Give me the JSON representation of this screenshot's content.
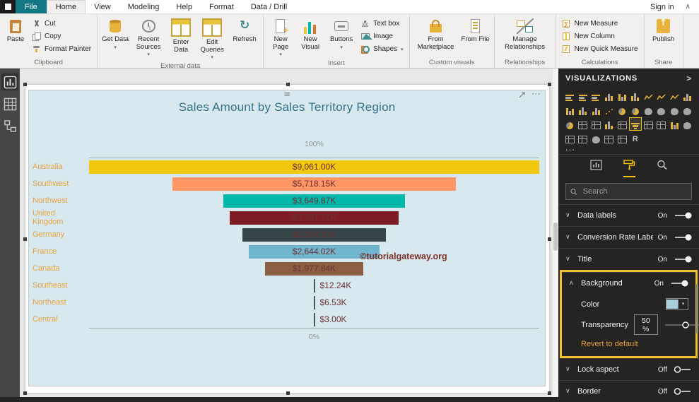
{
  "app": {
    "file_label": "File",
    "tabs": [
      "Home",
      "View",
      "Modeling",
      "Help",
      "Format",
      "Data / Drill"
    ],
    "active_tab": "Home",
    "sign_in_label": "Sign in",
    "collapse_ribbon_icon": "∧"
  },
  "ribbon": {
    "groups": [
      {
        "label": "Clipboard",
        "buttons": [
          {
            "label": "Paste",
            "icon": "paste-icon"
          },
          {
            "label": "Cut",
            "icon": "scissors-icon",
            "size": "small"
          },
          {
            "label": "Copy",
            "icon": "copy-icon",
            "size": "small"
          },
          {
            "label": "Format Painter",
            "icon": "format-painter-icon",
            "size": "small"
          }
        ]
      },
      {
        "label": "External data",
        "buttons": [
          {
            "label": "Get Data",
            "icon": "database-icon",
            "dropdown": true
          },
          {
            "label": "Recent Sources",
            "icon": "recent-sources-icon",
            "dropdown": true
          },
          {
            "label": "Enter Data",
            "icon": "enter-data-icon"
          },
          {
            "label": "Edit Queries",
            "icon": "edit-queries-icon",
            "dropdown": true
          },
          {
            "label": "Refresh",
            "icon": "refresh-icon"
          }
        ]
      },
      {
        "label": "Insert",
        "buttons": [
          {
            "label": "New Page",
            "icon": "new-page-icon",
            "dropdown": true
          },
          {
            "label": "New Visual",
            "icon": "new-visual-icon"
          },
          {
            "label": "Buttons",
            "icon": "buttons-icon",
            "dropdown": true
          },
          {
            "label": "Text box",
            "icon": "textbox-icon",
            "size": "small"
          },
          {
            "label": "Image",
            "icon": "image-icon",
            "size": "small"
          },
          {
            "label": "Shapes",
            "icon": "shapes-icon",
            "size": "small",
            "dropdown": true
          }
        ]
      },
      {
        "label": "Custom visuals",
        "buttons": [
          {
            "label": "From Marketplace",
            "icon": "marketplace-icon"
          },
          {
            "label": "From File",
            "icon": "from-file-icon"
          }
        ]
      },
      {
        "label": "Relationships",
        "buttons": [
          {
            "label": "Manage Relationships",
            "icon": "manage-relationships-icon"
          }
        ]
      },
      {
        "label": "Calculations",
        "buttons": [
          {
            "label": "New Measure",
            "icon": "new-measure-icon",
            "size": "small"
          },
          {
            "label": "New Column",
            "icon": "new-column-icon",
            "size": "small"
          },
          {
            "label": "New Quick Measure",
            "icon": "quick-measure-icon",
            "size": "small"
          }
        ]
      },
      {
        "label": "Share",
        "buttons": [
          {
            "label": "Publish",
            "icon": "publish-icon"
          }
        ]
      }
    ]
  },
  "view_sidebar": {
    "items": [
      "report-view",
      "data-view",
      "model-view"
    ],
    "active": "report-view"
  },
  "canvas": {
    "grip": "≡",
    "more_icon": "⋯"
  },
  "chart_data": {
    "type": "funnel",
    "title": "Sales Amount by Sales Territory Region",
    "categories": [
      "Australia",
      "Southwest",
      "Northwest",
      "United Kingdom",
      "Germany",
      "France",
      "Canada",
      "Southeast",
      "Northeast",
      "Central"
    ],
    "values": [
      9061.0,
      5718.15,
      3649.87,
      3391.71,
      2894.31,
      2644.02,
      1977.84,
      12.24,
      6.53,
      3.0
    ],
    "value_labels": [
      "$9,061.00K",
      "$5,718.15K",
      "$3,649.87K",
      "$3,391.71K",
      "$2,894.31K",
      "$2,644.02K",
      "$1,977.84K",
      "$12.24K",
      "$6.53K",
      "$3.00K"
    ],
    "bar_colors": [
      "#F2C80F",
      "#FE9666",
      "#01B8AA",
      "#7E1E24",
      "#374649",
      "#6FB5CD",
      "#8C5F42",
      "#4A5459",
      "#4A5459",
      "#4A5459"
    ],
    "top_axis_label": "100%",
    "bottom_axis_label": "0%",
    "watermark": "©tutorialgateway.org",
    "background": "#D7E8EF",
    "title_color": "#36718A",
    "category_color": "#E9A13B",
    "value_color": "#6D2F36",
    "watermark_color": "#7D3226",
    "axis_range": [
      "0%",
      "100%"
    ],
    "legend": "off",
    "grid": "off"
  },
  "visualizations_panel": {
    "title": "VISUALIZATIONS",
    "collapse_icon": ">",
    "icons": [
      "stacked-bar-chart",
      "clustered-bar-chart",
      "100-stacked-bar-chart",
      "stacked-column-chart",
      "clustered-column-chart",
      "100-stacked-column-chart",
      "line-chart",
      "area-chart",
      "stacked-area-chart",
      "line-and-stacked-column-chart",
      "line-and-clustered-column-chart",
      "ribbon-chart",
      "waterfall-chart",
      "scatter-chart",
      "pie-chart",
      "donut-chart",
      "treemap",
      "map",
      "filled-map",
      "shape-map",
      "gauge",
      "card",
      "multi-row-card",
      "kpi",
      "slicer",
      "funnel-chart",
      "table",
      "matrix",
      "key-influencers",
      "arcgis-map",
      "q-and-a",
      "smart-narrative",
      "decomposition-tree",
      "power-apps",
      "paginated-report",
      "r-script-visual"
    ],
    "selected_icon": "funnel-chart",
    "more_label": "...",
    "tabs": [
      "fields",
      "format",
      "analytics"
    ],
    "active_tab": "format",
    "search_placeholder": "Search",
    "format_sections": [
      {
        "label": "Data labels",
        "state": "On",
        "expanded": false
      },
      {
        "label": "Conversion Rate Label",
        "state": "On",
        "expanded": false
      },
      {
        "label": "Title",
        "state": "On",
        "expanded": false
      },
      {
        "label": "Background",
        "state": "On",
        "expanded": true,
        "highlight": true,
        "controls": {
          "color_label": "Color",
          "transparency_label": "Transparency",
          "transparency_value": "50 %",
          "revert_label": "Revert to default"
        }
      },
      {
        "label": "Lock aspect",
        "state": "Off",
        "expanded": false
      },
      {
        "label": "Border",
        "state": "Off",
        "expanded": false
      }
    ],
    "swatch_color": "#A9CEDC",
    "highlight_color": "#F2C033"
  }
}
